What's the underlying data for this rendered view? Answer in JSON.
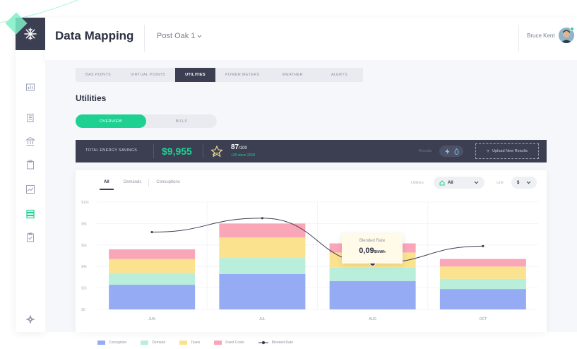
{
  "app": {
    "title": "Data Mapping",
    "site": "Post Oak 1",
    "user_name": "Bruce Kent"
  },
  "sidebar": {
    "items": [
      {
        "name": "building-chart-icon"
      },
      {
        "name": "building-icon"
      },
      {
        "name": "bank-icon"
      },
      {
        "name": "clipboard-icon"
      },
      {
        "name": "trend-chart-icon"
      },
      {
        "name": "data-mapping-icon",
        "active": true
      },
      {
        "name": "checklist-icon"
      },
      {
        "name": "settings-icon"
      }
    ]
  },
  "top_tabs": [
    "BAS POINTS",
    "VIRTUAL POINTS",
    "UTILITIES",
    "POWER METERS",
    "WEATHER",
    "ALERTS"
  ],
  "top_tabs_active": "UTILITIES",
  "section_title": "Utilities",
  "segmented": {
    "overview": "OVERVIEW",
    "bills": "BILLS",
    "active": "OVERVIEW"
  },
  "savings": {
    "label": "TOTAL ENERGY SAVINGS",
    "value": "$9,955",
    "score": "87",
    "score_max": "/100",
    "score_change": "+20 since 2018",
    "results_label": "Results",
    "upload_label": "Upload New Results"
  },
  "chart_controls": {
    "tabs": [
      "All",
      "Demands",
      "Consuptions"
    ],
    "active_tab": "All",
    "utilities_label": "Utilities",
    "utilities_value": "All",
    "unit_label": "Unit",
    "unit_value": "$"
  },
  "tooltip": {
    "title": "Blended Rate",
    "value": "0,09",
    "unit": "$/kWh"
  },
  "colors": {
    "consumption": "#95acf5",
    "demand": "#b9eedb",
    "taxes": "#fbe28f",
    "fixed_costs": "#f9a6b9",
    "blended_rate": "#3b3f51",
    "accent": "#1ed193",
    "dark": "#3b3f51"
  },
  "chart_data": {
    "type": "bar",
    "stacked": true,
    "categories": [
      "JUN",
      "JUL",
      "AUG",
      "OCT"
    ],
    "y_tick_labels": [
      "$0",
      "$2k",
      "$4k",
      "$6k",
      "$8k",
      "$10k"
    ],
    "ylim": [
      0,
      10000
    ],
    "series": [
      {
        "name": "Consuption",
        "values": [
          2300,
          3300,
          2650,
          1900
        ]
      },
      {
        "name": "Demand",
        "values": [
          1100,
          1500,
          1250,
          950
        ]
      },
      {
        "name": "Taxes",
        "values": [
          1300,
          1900,
          1400,
          1150
        ]
      },
      {
        "name": "Fixed Costs",
        "values": [
          900,
          1300,
          850,
          700
        ]
      }
    ],
    "line_series": {
      "name": "Blended Rate",
      "values": [
        7200,
        8500,
        4300,
        5900
      ]
    },
    "legend_position": "bottom",
    "grid": true
  }
}
